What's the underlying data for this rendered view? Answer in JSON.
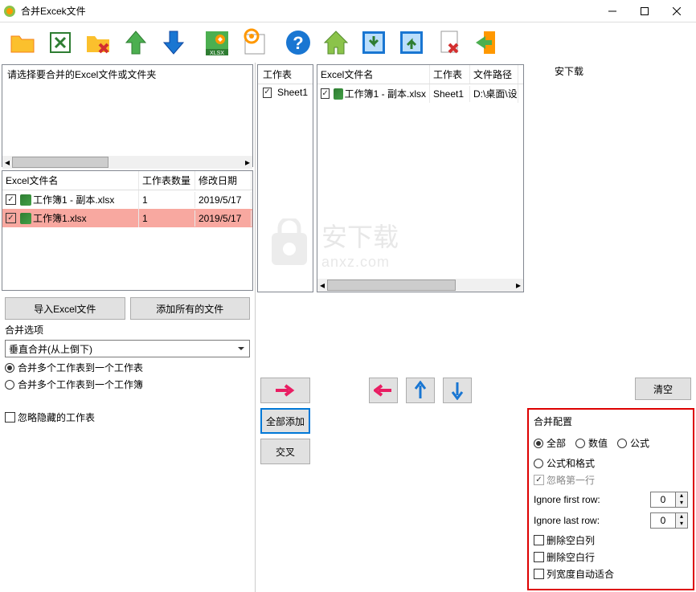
{
  "window": {
    "title": "合并Excek文件"
  },
  "download_label": "安下载",
  "left": {
    "prompt": "请选择要合并的Excel文件或文件夹",
    "table": {
      "headers": {
        "name": "Excel文件名",
        "sheets": "工作表数量",
        "date": "修改日期"
      },
      "rows": [
        {
          "name": "工作簿1 - 副本.xlsx",
          "sheets": "1",
          "date": "2019/5/17"
        },
        {
          "name": "工作簿1.xlsx",
          "sheets": "1",
          "date": "2019/5/17"
        }
      ]
    },
    "import_btn": "导入Excel文件",
    "add_all_btn": "添加所有的文件",
    "merge_options_label": "合并选项",
    "merge_direction": "垂直合并(从上倒下)",
    "opt1": "合并多个工作表到一个工作表",
    "opt2": "合并多个工作表到一个工作簿",
    "ignore_hidden": "忽略隐藏的工作表"
  },
  "mid": {
    "sheet_header": "工作表",
    "sheet_name": "Sheet1",
    "add_all": "全部添加",
    "cross": "交叉"
  },
  "right_panel": {
    "headers": {
      "name": "Excel文件名",
      "sheet": "工作表",
      "path": "文件路径"
    },
    "rows": [
      {
        "name": "工作簿1 - 副本.xlsx",
        "sheet": "Sheet1",
        "path": "D:\\桌面\\设"
      }
    ]
  },
  "clear_btn": "清空",
  "config": {
    "title": "合并配置",
    "r_all": "全部",
    "r_value": "数值",
    "r_formula": "公式",
    "r_formula_format": "公式和格式",
    "ignore_first_line": "忽略第一行",
    "ignore_first_row": "Ignore first row:",
    "ignore_last_row": "Ignore last row:",
    "val_first": "0",
    "val_last": "0",
    "del_empty_col": "删除空白列",
    "del_empty_row": "删除空白行",
    "auto_col_width": "列宽度自动适合"
  },
  "watermark": {
    "zh": "安下载",
    "en": "anxz.com"
  }
}
